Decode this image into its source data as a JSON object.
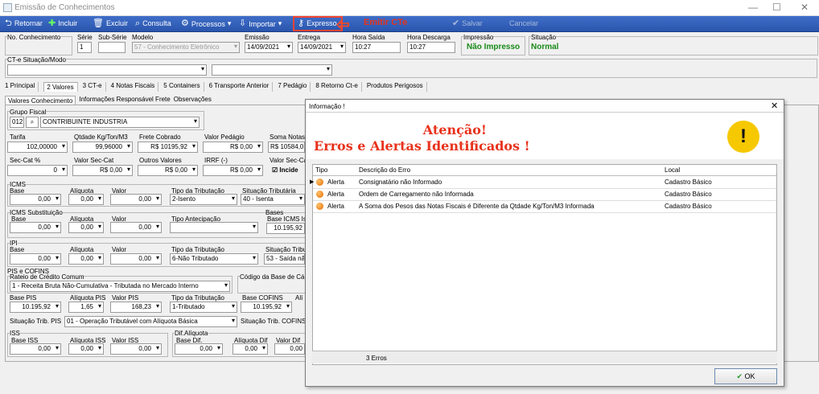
{
  "window": {
    "title": "Emissão de Conhecimentos"
  },
  "toolbar": {
    "retornar": "Retornar",
    "incluir": "Incluir",
    "excluir": "Excluir",
    "consulta": "Consulta",
    "processos": "Processos",
    "importar": "Importar",
    "expresso": "Expresso",
    "salvar": "Salvar",
    "cancelar": "Cancelar"
  },
  "annotation": {
    "emitir": "Emitir CTe"
  },
  "header": {
    "no_conhecimento_label": "No. Conhecimento",
    "serie_label": "Série",
    "serie": "1",
    "subserie_label": "Sub-Série",
    "modelo_label": "Modelo",
    "modelo": "57 - Conhecimento Eletrônico",
    "emissao_label": "Emissão",
    "emissao": "14/09/2021",
    "entrega_label": "Entrega",
    "entrega": "14/09/2021",
    "hora_saida_label": "Hora Saída",
    "hora_saida": "10:27",
    "hora_descarga_label": "Hora Descarga",
    "hora_descarga": "10:27",
    "impressao_label": "Impressão",
    "impressao": "Não Impresso",
    "situacao_label": "Situação",
    "situacao": "Normal",
    "cte_situacao_label": "CT-e Situação/Modo"
  },
  "tabs": [
    "1 Principal",
    "2 Valores",
    "3 CT-e",
    "4 Notas Fiscais",
    "5 Containers",
    "6 Transporte Anterior",
    "7 Pedágio",
    "8 Retorno Ct-e",
    "Produtos Perigosos"
  ],
  "subtabs": [
    "Valores Conhecimento",
    "Informações Responsável Frete",
    "Observações"
  ],
  "valores": {
    "grupo_fiscal_label": "Grupo Fiscal",
    "grupo_code": "012",
    "grupo": "CONTRIBUINTE INDUSTRIA",
    "tarifa_label": "Tarifa",
    "tarifa": "102,00000",
    "qtdade_label": "Qtdade Kg/Ton/M3",
    "qtdade": "99,96000",
    "frete_label": "Frete Cobrado",
    "frete": "R$ 10195,92",
    "pedagio_label": "Valor Pedágio",
    "pedagio": "R$ 0,00",
    "soma_label": "Soma Notas",
    "soma": "R$ 10584,0",
    "seccat_label": "Sec-Cat %",
    "seccat": "0",
    "valor_seccat_label": "Valor Sec-Cat",
    "valor_seccat": "R$ 0,00",
    "outros_label": "Outros Valores",
    "outros": "R$ 0,00",
    "irrf_label": "IRRF (-)",
    "irrf": "R$ 0,00",
    "valor_secca_label": "Valor Sec-Ca",
    "incide_label": "Incide",
    "icms_label": "ICMS",
    "base_label": "Base",
    "aliquota_label": "Alíquota",
    "valor_label": "Valor",
    "icms_base": "0,00",
    "icms_aliq": "0,00",
    "icms_valor": "0,00",
    "tipo_trib_label": "Tipo da Tributação",
    "icms_tipo": "2-Isento",
    "sit_trib_label": "Situação Tributária",
    "icms_sit": "40 - Isenta",
    "icms_sub_label": "ICMS Substituição",
    "sub_base": "0,00",
    "sub_aliq": "0,00",
    "sub_valor": "0,00",
    "tipo_antecip_label": "Tipo Antecipação",
    "bases_label": "Bases",
    "base_icms_label": "Base ICMS Ise",
    "base_icms": "10.195,92",
    "ipi_label": "IPI",
    "ipi_base": "0,00",
    "ipi_aliq": "0,00",
    "ipi_valor": "0,00",
    "ipi_tipo": "6-Não Tributado",
    "ipi_sit_label": "Situação Tribut",
    "ipi_sit": "53 - Saída não",
    "pis_cofins_label": "PIS e COFINS",
    "rateio_label": "Rateio de Crédito Comum",
    "rateio": "1 - Receita Bruta Não-Cumulativa - Tributada no Mercado Interno",
    "codigo_base_label": "Código da Base de Cálc",
    "base_pis_label": "Base PIS",
    "base_pis": "10.195,92",
    "aliq_pis_label": "Alíquota PIS",
    "aliq_pis": "1,65",
    "valor_pis_label": "Valor PIS",
    "valor_pis": "168,23",
    "pis_tipo": "1-Tributado",
    "base_cofins_label": "Base COFINS",
    "base_cofins": "10.195,92",
    "ali_label": "Alí",
    "sit_pis_label": "Situação Trib. PIS",
    "sit_pis": "01 - Operação Tributável com Alíquota Básica",
    "sit_cofins_label": "Situação Trib. COFINS",
    "iss_label": "ISS",
    "base_iss_label": "Base ISS",
    "base_iss": "0,00",
    "aliq_iss_label": "Alíquota ISS",
    "aliq_iss": "0,00",
    "valor_iss_label": "Valor ISS",
    "valor_iss": "0,00",
    "dif_label": "Dif.Alíquota",
    "base_dif_label": "Base Dif.",
    "base_dif": "0,00",
    "aliq_dif_label": "Alíquota Dif",
    "aliq_dif": "0,00",
    "valor_dif_label": "Valor Dif",
    "valor_dif": "0,00"
  },
  "dialog": {
    "title": "Informação !",
    "heading1": "Atenção!",
    "heading2": "Erros e Alertas Identificados !",
    "columns": {
      "tipo": "Tipo",
      "descricao": "Descrição do Erro",
      "local": "Local"
    },
    "rows": [
      {
        "tipo": "Alerta",
        "descricao": "Consignatário não Informado",
        "local": "Cadastro Básico"
      },
      {
        "tipo": "Alerta",
        "descricao": "Ordem de Carregamento não Informada",
        "local": "Cadastro Básico"
      },
      {
        "tipo": "Alerta",
        "descricao": "A Soma dos Pesos das Notas Fiscais é Diferente da Qtdade Kg/Ton/M3 Informada",
        "local": "Cadastro Básico"
      }
    ],
    "footer": "3 Erros",
    "ok": "OK"
  }
}
